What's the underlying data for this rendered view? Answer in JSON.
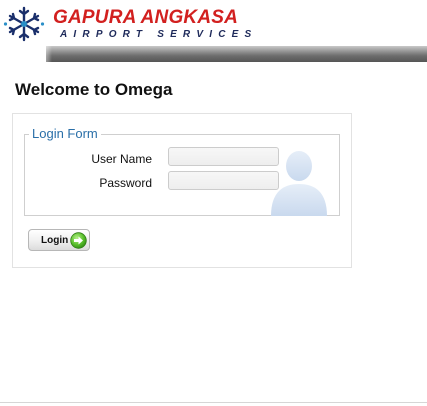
{
  "header": {
    "brand_name": "GAPURA ANGKASA",
    "brand_subtitle": "AIRPORT SERVICES",
    "logo_icon": "snowflake-logo-icon",
    "brand_color": "#d2201f",
    "subtitle_color": "#1e2a5a"
  },
  "welcome": {
    "title": "Welcome to Omega"
  },
  "login_form": {
    "legend": "Login Form",
    "legend_color": "#2a6fa8",
    "username_label": "User Name",
    "username_value": "",
    "password_label": "Password",
    "password_value": "",
    "avatar_icon": "user-silhouette-icon",
    "login_button_label": "Login",
    "login_button_icon": "green-arrow-right-icon"
  }
}
